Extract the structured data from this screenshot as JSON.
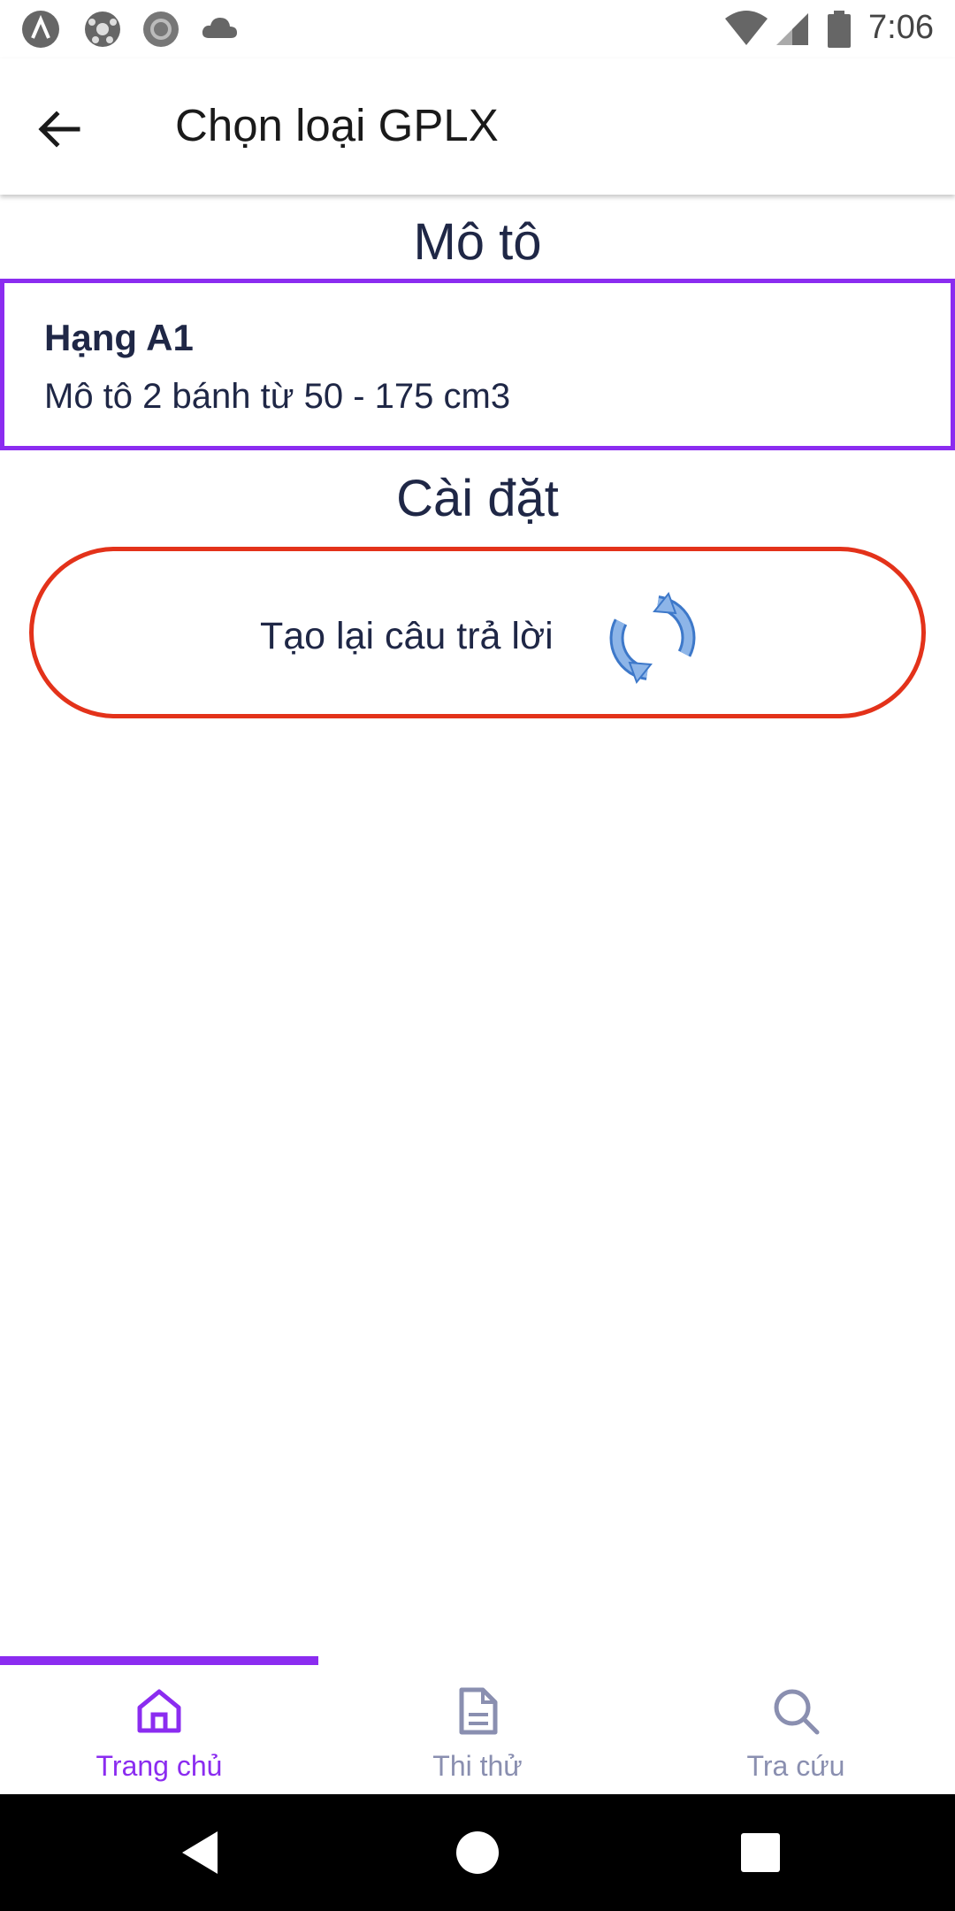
{
  "status_bar": {
    "time": "7:06",
    "left_icons": [
      "app-a-icon",
      "soccer-ball-icon",
      "circle-record-icon",
      "cloud-icon"
    ],
    "right_icons": [
      "wifi-icon",
      "signal-icon",
      "battery-icon"
    ]
  },
  "app_bar": {
    "title": "Chọn loại GPLX",
    "back_icon": "arrow-left-icon"
  },
  "sections": {
    "motorbike_title": "Mô tô",
    "settings_title": "Cài đặt"
  },
  "license_card": {
    "name": "Hạng A1",
    "description": "Mô tô 2 bánh từ 50 - 175 cm3"
  },
  "regenerate_button": {
    "label": "Tạo lại câu trả lời",
    "icon": "refresh-icon"
  },
  "bottom_nav": {
    "tabs": [
      {
        "label": "Trang chủ",
        "icon": "home-icon",
        "active": true
      },
      {
        "label": "Thi thử",
        "icon": "document-icon",
        "active": false
      },
      {
        "label": "Tra cứu",
        "icon": "search-icon",
        "active": false
      }
    ]
  },
  "colors": {
    "accent": "#8b2cf0",
    "regen_border": "#e3321a",
    "inactive_nav": "#8a8fb0",
    "text": "#1f2746"
  }
}
